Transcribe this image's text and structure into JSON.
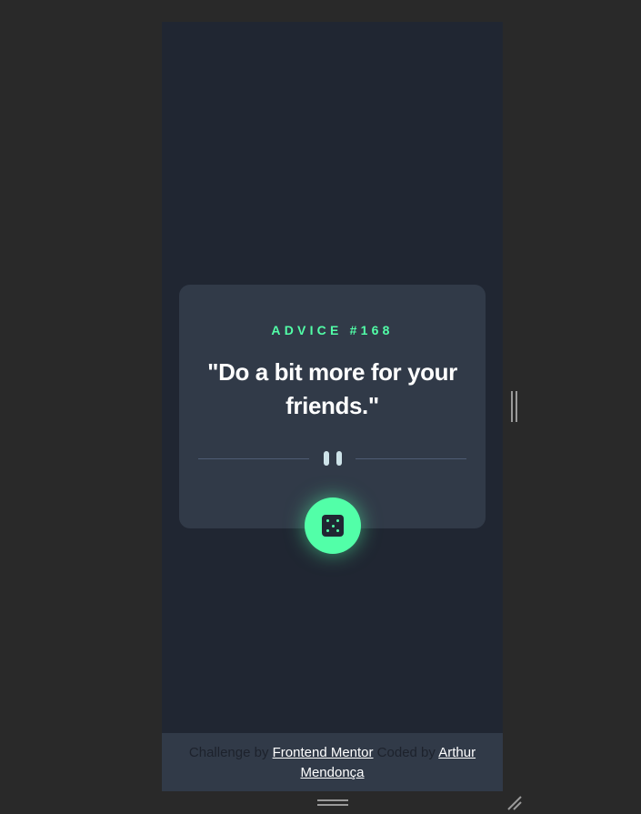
{
  "card": {
    "advice_id": "ADVICE #168",
    "advice_text": "\"Do a bit more for your friends.\""
  },
  "dice_button": {
    "icon": "dice-icon"
  },
  "footer": {
    "challenge_prefix": "Challenge by ",
    "challenge_link": "Frontend Mentor",
    "coded_prefix": " Coded by ",
    "coded_link": "Arthur Mendonça"
  },
  "colors": {
    "background": "#202632",
    "card": "#313a48",
    "accent": "#52ffa8",
    "text": "#ffffff",
    "divider": "#4f5d74"
  }
}
